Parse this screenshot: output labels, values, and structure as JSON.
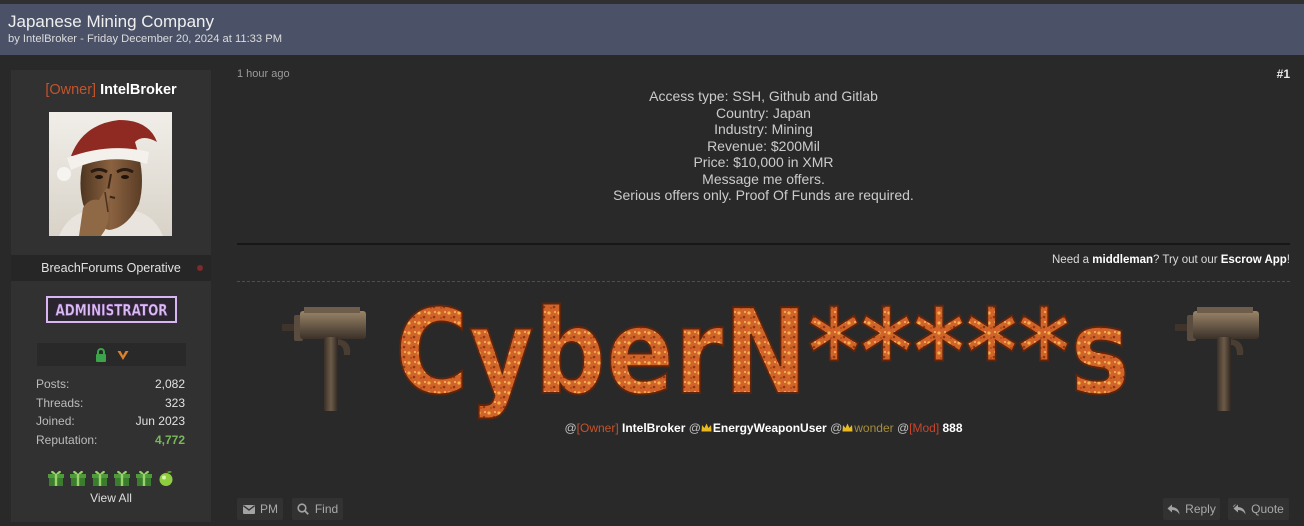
{
  "thread": {
    "title": "Japanese Mining Company",
    "byline": "by IntelBroker - Friday December 20, 2024 at 11:33 PM"
  },
  "author": {
    "rank_tag": "[Owner]",
    "username": "IntelBroker",
    "user_title": "BreachForums Operative",
    "group_badge": "ADMINISTRATOR",
    "status_icons": [
      "lock-icon",
      "vip-v-icon"
    ],
    "stats": [
      {
        "label": "Posts:",
        "value": "2,082"
      },
      {
        "label": "Threads:",
        "value": "323"
      },
      {
        "label": "Joined:",
        "value": "Jun 2023"
      },
      {
        "label": "Reputation:",
        "value": "4,772"
      }
    ],
    "awards": [
      "gift-icon",
      "gift-icon",
      "gift-icon",
      "gift-icon",
      "gift-icon",
      "apple-icon"
    ],
    "awards_link": "View All"
  },
  "post": {
    "time": "1 hour ago",
    "number": "#1",
    "body_lines": [
      "Access type: SSH, Github and Gitlab",
      "Country: Japan",
      "Industry: Mining",
      "Revenue: $200Mil",
      "Price: $10,000 in XMR",
      "Message me offers.",
      "Serious offers only. Proof Of Funds are required."
    ]
  },
  "escrow_notice": {
    "part1": "Need a ",
    "highlight1": "middleman",
    "part2": "? Try out our ",
    "highlight2": "Escrow App",
    "part3": "!"
  },
  "signature": {
    "banner_text": "CyberN*****s",
    "banner_icons": [
      "uzi-gun-icon",
      "uzi-gun-icon"
    ],
    "mentions": [
      {
        "at": "@",
        "tag": "[Owner]",
        "name": "IntelBroker"
      },
      {
        "at": "@",
        "icon": "crown-icon",
        "name": "EnergyWeaponUser"
      },
      {
        "at": "@",
        "icon": "crown-icon",
        "name": "wonder"
      },
      {
        "at": "@",
        "tag": "[Mod]",
        "name": "888"
      }
    ]
  },
  "actions": {
    "left": [
      {
        "label": "PM",
        "icon": "mail-icon"
      },
      {
        "label": "Find",
        "icon": "search-icon"
      }
    ],
    "right": [
      {
        "label": "Reply",
        "icon": "reply-icon"
      },
      {
        "label": "Quote",
        "icon": "quote-icon"
      }
    ]
  },
  "colors": {
    "header_bg": "#4b5268",
    "page_bg": "#292929",
    "panel_bg": "#313131",
    "owner_tag": "#c4532b",
    "mod_tag": "#c8452d",
    "reputation": "#79b85a",
    "admin_badge": "#d8b6f1",
    "crown": "#e8b923",
    "wonder_name": "#a68f3c",
    "banner_text": "#d2642a"
  }
}
